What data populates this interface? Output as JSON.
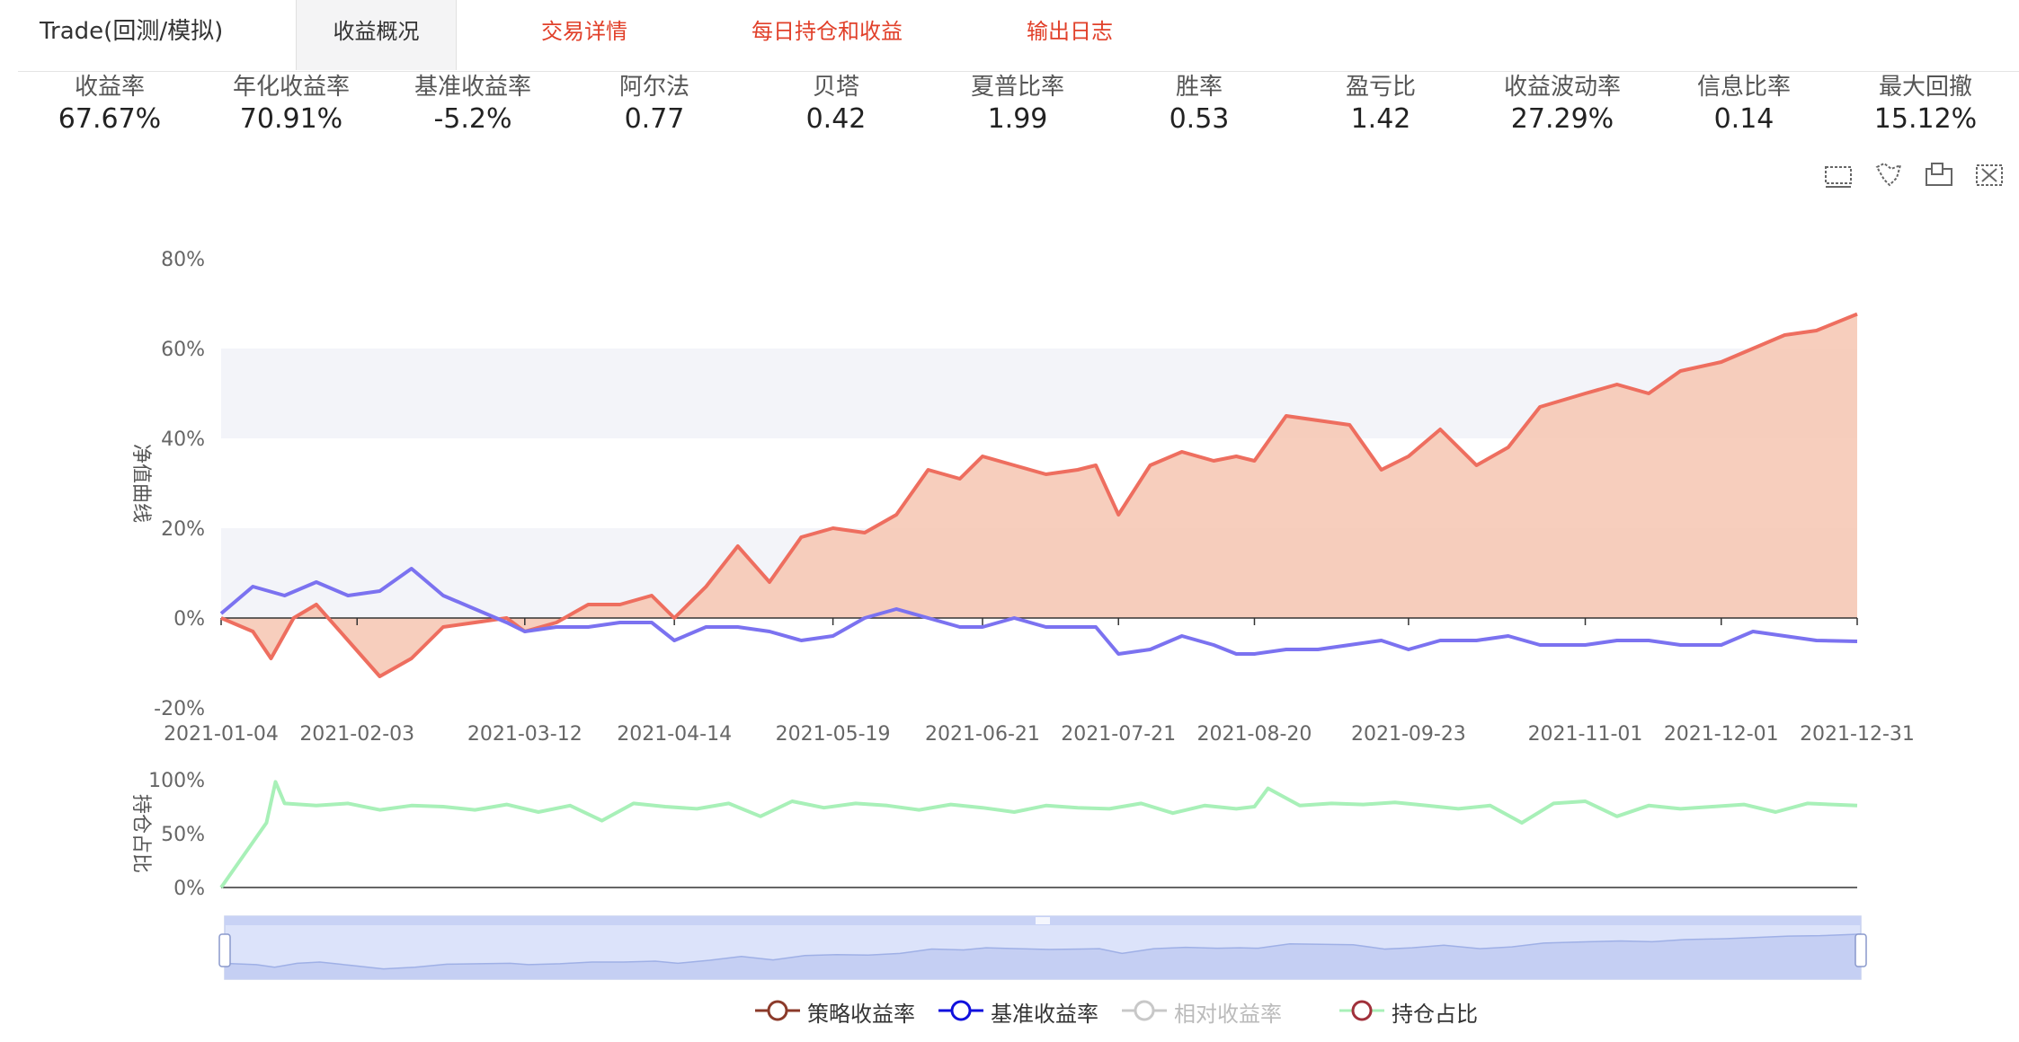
{
  "header": {
    "title": "Trade(回测/模拟)",
    "tabs": [
      {
        "label": "收益概况",
        "active": true
      },
      {
        "label": "交易详情",
        "active": false
      },
      {
        "label": "每日持仓和收益",
        "active": false
      },
      {
        "label": "输出日志",
        "active": false
      }
    ]
  },
  "metrics": [
    {
      "label": "收益率",
      "value": "67.67%"
    },
    {
      "label": "年化收益率",
      "value": "70.91%"
    },
    {
      "label": "基准收益率",
      "value": "-5.2%"
    },
    {
      "label": "阿尔法",
      "value": "0.77"
    },
    {
      "label": "贝塔",
      "value": "0.42"
    },
    {
      "label": "夏普比率",
      "value": "1.99"
    },
    {
      "label": "胜率",
      "value": "0.53"
    },
    {
      "label": "盈亏比",
      "value": "1.42"
    },
    {
      "label": "收益波动率",
      "value": "27.29%"
    },
    {
      "label": "信息比率",
      "value": "0.14"
    },
    {
      "label": "最大回撤",
      "value": "15.12%"
    }
  ],
  "toolbox": [
    "zoom-select-icon",
    "lasso-select-icon",
    "zoom-reset-icon",
    "clear-selection-icon"
  ],
  "colors": {
    "strategy": "#ee6e5f",
    "strategy_fill": "#f6c5b1",
    "benchmark": "#7b72f0",
    "holding": "#a8f0b8",
    "legend_strategy": "#8b3a2a",
    "legend_benchmark": "#1010dd",
    "legend_disabled": "#c8c8c8",
    "legend_holding": "#a0303a",
    "link": "#e1402a"
  },
  "legend": [
    {
      "label": "策略收益率",
      "enabled": true
    },
    {
      "label": "基准收益率",
      "enabled": true
    },
    {
      "label": "相对收益率",
      "enabled": false
    },
    {
      "label": "持仓占比",
      "enabled": true
    }
  ],
  "chart_data": [
    {
      "type": "area",
      "ylabel": "净值曲线",
      "ylim": [
        -20,
        80
      ],
      "yticks": [
        "-20%",
        "0%",
        "20%",
        "40%",
        "60%",
        "80%"
      ],
      "ytick_values": [
        -20,
        0,
        20,
        40,
        60,
        80
      ],
      "x_range": [
        "2021-01-04",
        "2021-12-31"
      ],
      "xticks": [
        "2021-01-04",
        "2021-02-03",
        "2021-03-12",
        "2021-04-14",
        "2021-05-19",
        "2021-06-21",
        "2021-07-21",
        "2021-08-20",
        "2021-09-23",
        "2021-11-01",
        "2021-12-01",
        "2021-12-31"
      ],
      "series": [
        {
          "name": "策略收益率",
          "x": [
            "2021-01-04",
            "2021-01-11",
            "2021-01-15",
            "2021-01-20",
            "2021-01-25",
            "2021-02-01",
            "2021-02-08",
            "2021-02-15",
            "2021-02-22",
            "2021-03-01",
            "2021-03-08",
            "2021-03-12",
            "2021-03-19",
            "2021-03-26",
            "2021-04-02",
            "2021-04-09",
            "2021-04-14",
            "2021-04-21",
            "2021-04-28",
            "2021-05-05",
            "2021-05-12",
            "2021-05-19",
            "2021-05-26",
            "2021-06-02",
            "2021-06-09",
            "2021-06-16",
            "2021-06-21",
            "2021-06-28",
            "2021-07-05",
            "2021-07-12",
            "2021-07-16",
            "2021-07-21",
            "2021-07-28",
            "2021-08-04",
            "2021-08-11",
            "2021-08-16",
            "2021-08-20",
            "2021-08-27",
            "2021-09-03",
            "2021-09-10",
            "2021-09-17",
            "2021-09-23",
            "2021-09-30",
            "2021-10-08",
            "2021-10-15",
            "2021-10-22",
            "2021-11-01",
            "2021-11-08",
            "2021-11-15",
            "2021-11-22",
            "2021-12-01",
            "2021-12-08",
            "2021-12-15",
            "2021-12-22",
            "2021-12-31"
          ],
          "values": [
            0,
            -3,
            -9,
            0,
            3,
            -5,
            -13,
            -9,
            -2,
            -1,
            0,
            -3,
            -1,
            3,
            3,
            5,
            0,
            7,
            16,
            8,
            18,
            20,
            19,
            23,
            33,
            31,
            36,
            34,
            32,
            33,
            34,
            23,
            34,
            37,
            35,
            36,
            35,
            45,
            44,
            43,
            33,
            36,
            42,
            34,
            38,
            47,
            50,
            52,
            50,
            55,
            57,
            60,
            63,
            64,
            67.67
          ]
        },
        {
          "name": "基准收益率",
          "x": [
            "2021-01-04",
            "2021-01-11",
            "2021-01-18",
            "2021-01-25",
            "2021-02-01",
            "2021-02-08",
            "2021-02-15",
            "2021-02-22",
            "2021-03-01",
            "2021-03-08",
            "2021-03-12",
            "2021-03-19",
            "2021-03-26",
            "2021-04-02",
            "2021-04-09",
            "2021-04-14",
            "2021-04-21",
            "2021-04-28",
            "2021-05-05",
            "2021-05-12",
            "2021-05-19",
            "2021-05-26",
            "2021-06-02",
            "2021-06-09",
            "2021-06-16",
            "2021-06-21",
            "2021-06-28",
            "2021-07-05",
            "2021-07-12",
            "2021-07-16",
            "2021-07-21",
            "2021-07-28",
            "2021-08-04",
            "2021-08-11",
            "2021-08-16",
            "2021-08-20",
            "2021-08-27",
            "2021-09-03",
            "2021-09-10",
            "2021-09-17",
            "2021-09-23",
            "2021-09-30",
            "2021-10-08",
            "2021-10-15",
            "2021-10-22",
            "2021-11-01",
            "2021-11-08",
            "2021-11-15",
            "2021-11-22",
            "2021-12-01",
            "2021-12-08",
            "2021-12-15",
            "2021-12-22",
            "2021-12-31"
          ],
          "values": [
            1,
            7,
            5,
            8,
            5,
            6,
            11,
            5,
            2,
            -1,
            -3,
            -2,
            -2,
            -1,
            -1,
            -5,
            -2,
            -2,
            -3,
            -5,
            -4,
            0,
            2,
            0,
            -2,
            -2,
            0,
            -2,
            -2,
            -2,
            -8,
            -7,
            -4,
            -6,
            -8,
            -8,
            -7,
            -7,
            -6,
            -5,
            -7,
            -5,
            -5,
            -4,
            -6,
            -6,
            -5,
            -5,
            -6,
            -6,
            -3,
            -4,
            -5,
            -5.2
          ]
        }
      ]
    },
    {
      "type": "line",
      "ylabel": "持仓占比",
      "ylim": [
        0,
        100
      ],
      "yticks": [
        "0%",
        "50%",
        "100%"
      ],
      "ytick_values": [
        0,
        50,
        100
      ],
      "x_range": [
        "2021-01-04",
        "2021-12-31"
      ],
      "series": [
        {
          "name": "持仓占比",
          "x": [
            "2021-01-04",
            "2021-01-14",
            "2021-01-16",
            "2021-01-18",
            "2021-01-25",
            "2021-02-01",
            "2021-02-08",
            "2021-02-15",
            "2021-02-22",
            "2021-03-01",
            "2021-03-08",
            "2021-03-15",
            "2021-03-22",
            "2021-03-29",
            "2021-04-05",
            "2021-04-12",
            "2021-04-19",
            "2021-04-26",
            "2021-05-03",
            "2021-05-10",
            "2021-05-17",
            "2021-05-24",
            "2021-05-31",
            "2021-06-07",
            "2021-06-14",
            "2021-06-21",
            "2021-06-28",
            "2021-07-05",
            "2021-07-12",
            "2021-07-19",
            "2021-07-26",
            "2021-08-02",
            "2021-08-09",
            "2021-08-16",
            "2021-08-20",
            "2021-08-23",
            "2021-08-30",
            "2021-09-06",
            "2021-09-13",
            "2021-09-20",
            "2021-09-27",
            "2021-10-04",
            "2021-10-11",
            "2021-10-18",
            "2021-10-25",
            "2021-11-01",
            "2021-11-08",
            "2021-11-15",
            "2021-11-22",
            "2021-11-29",
            "2021-12-06",
            "2021-12-13",
            "2021-12-20",
            "2021-12-31"
          ],
          "values": [
            0,
            60,
            98,
            78,
            76,
            78,
            72,
            76,
            75,
            72,
            77,
            70,
            76,
            62,
            78,
            75,
            73,
            78,
            66,
            80,
            74,
            78,
            76,
            72,
            77,
            74,
            70,
            76,
            74,
            73,
            78,
            69,
            76,
            73,
            75,
            92,
            76,
            78,
            77,
            79,
            76,
            73,
            76,
            60,
            78,
            80,
            66,
            76,
            73,
            75,
            77,
            70,
            78,
            76
          ]
        }
      ]
    }
  ]
}
